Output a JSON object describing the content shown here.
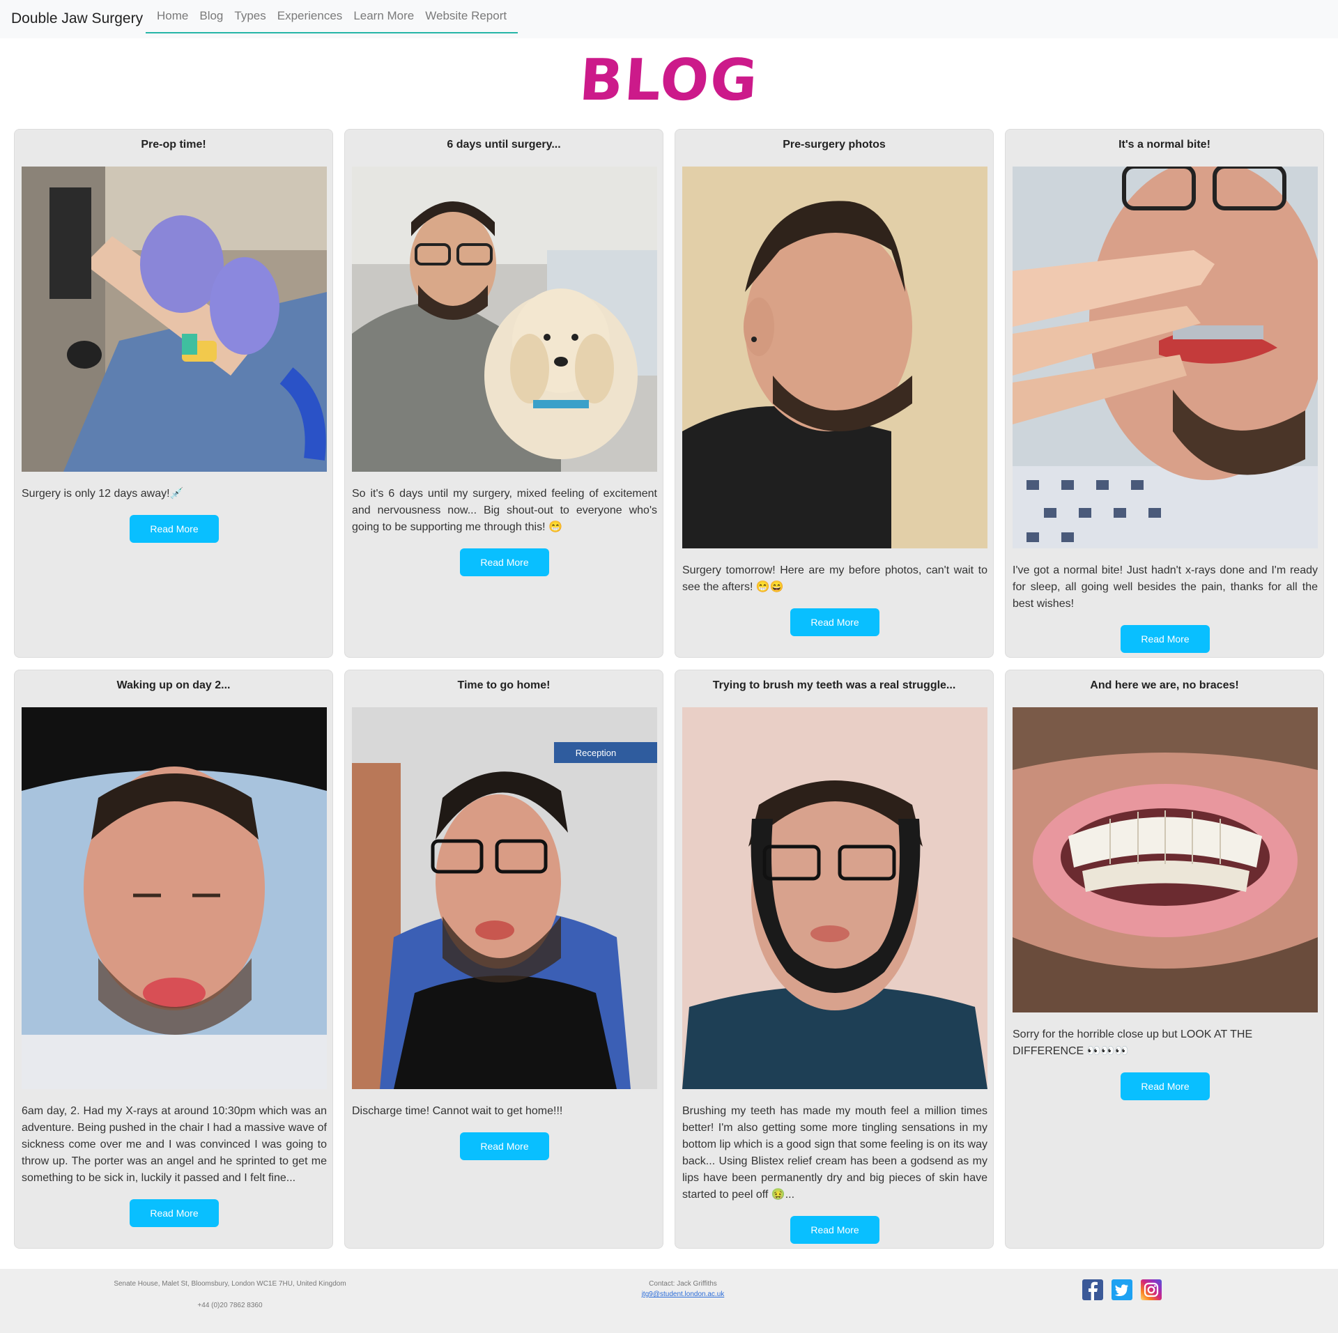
{
  "nav": {
    "brand": "Double Jaw Surgery",
    "links": [
      "Home",
      "Blog",
      "Types",
      "Experiences",
      "Learn More",
      "Website Report"
    ]
  },
  "page_title": "BLOG",
  "cards": [
    {
      "title": "Pre-op time!",
      "text": "Surgery is only 12 days away!💉",
      "button": "Read More"
    },
    {
      "title": "6 days until surgery...",
      "text": "So it's 6 days until my surgery, mixed feeling of excitement and nervousness now... Big shout-out to everyone who's going to be supporting me through this! 😁",
      "button": "Read More"
    },
    {
      "title": "Pre-surgery photos",
      "text": "Surgery tomorrow! Here are my before photos, can't wait to see the afters! 😁😄",
      "button": "Read More"
    },
    {
      "title": "It's a normal bite!",
      "text": "I've got a normal bite! Just hadn't x-rays done and I'm ready for sleep, all going well besides the pain, thanks for all the best wishes!",
      "button": "Read More"
    },
    {
      "title": "Waking up on day 2...",
      "text": "6am day, 2. Had my X-rays at around 10:30pm which was an adventure. Being pushed in the chair I had a massive wave of sickness come over me and I was convinced I was going to throw up. The porter was an angel and he sprinted to get me something to be sick in, luckily it passed and I felt fine...",
      "button": "Read More"
    },
    {
      "title": "Time to go home!",
      "text": "Discharge time! Cannot wait to get home!!!",
      "button": "Read More",
      "photo_sign": "Reception"
    },
    {
      "title": "Trying to brush my teeth was a real struggle...",
      "text": "Brushing my teeth has made my mouth feel a million times better! I'm also getting some more tingling sensations in my bottom lip which is a good sign that some feeling is on its way back... Using Blistex relief cream has been a godsend as my lips have been permanently dry and big pieces of skin have started to peel off 🤢...",
      "button": "Read More"
    },
    {
      "title": "And here we are, no braces!",
      "text": "Sorry for the horrible close up but LOOK AT THE DIFFERENCE 👀👀👀",
      "button": "Read More"
    }
  ],
  "footer": {
    "address": "Senate House, Malet St, Bloomsbury, London WC1E 7HU, United Kingdom",
    "phone": "+44 (0)20 7862 8360",
    "contact": "Contact: Jack Griffiths",
    "email": "jtg9@student.london.ac.uk",
    "social": [
      "facebook-icon",
      "twitter-icon",
      "instagram-icon"
    ]
  },
  "colors": {
    "accent": "#09bfff",
    "title": "#cc1a8a",
    "nav_underline": "#26b5a7",
    "card_bg": "#e9e9e9"
  }
}
